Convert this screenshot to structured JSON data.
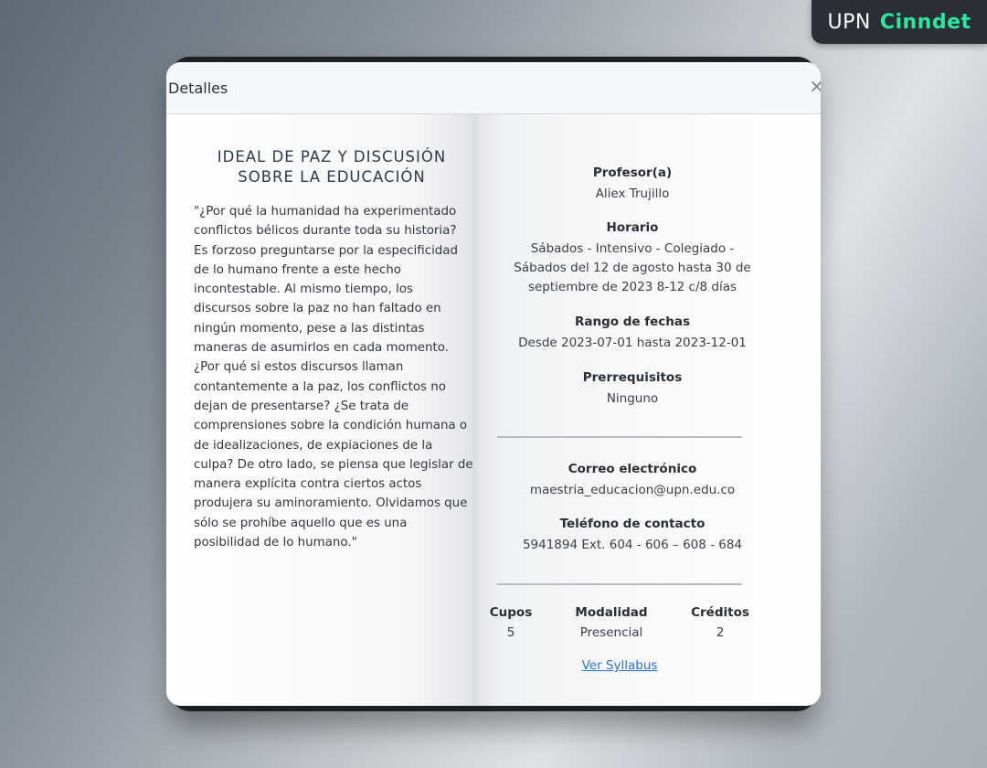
{
  "brand": {
    "part1": "UPN",
    "part2": "Cinndet",
    "accent_color": "#2ee6a0"
  },
  "modal": {
    "title": "Detalles",
    "close_icon": "×"
  },
  "course": {
    "title_line1": "IDEAL DE PAZ Y DISCUSIÓN",
    "title_line2": "SOBRE LA EDUCACIÓN",
    "description": "\"¿Por qué la humanidad ha experimentado conflictos bélicos durante toda su historia? Es forzoso preguntarse por la especificidad de lo humano frente a este hecho incontestable. Al mismo tiempo, los discursos sobre la paz no han faltado en ningún momento, pese a las distintas maneras de asumirlos en cada momento. ¿Por qué si estos discursos llaman contantemente a la paz, los conflictos no dejan de presentarse? ¿Se trata de comprensiones sobre la condición humana o de idealizaciones, de expiaciones de la culpa? De otro lado, se piensa que legislar de manera explícita contra ciertos actos produjera su aminoramiento. Olvidamos que sólo se prohíbe aquello que es una posibilidad de lo humano.\""
  },
  "details": {
    "profesor_label": "Profesor(a)",
    "profesor_value": "Aliex Trujillo",
    "horario_label": "Horario",
    "horario_value": "Sábados - Intensivo - Colegiado - Sábados del 12 de agosto hasta 30 de septiembre de 2023 8-12 c/8 días",
    "rango_label": "Rango de fechas",
    "rango_value": "Desde 2023-07-01 hasta 2023-12-01",
    "prerrequisitos_label": "Prerrequisitos",
    "prerrequisitos_value": "Ninguno",
    "correo_label": "Correo electrónico",
    "correo_value": "maestria_educacion@upn.edu.co",
    "telefono_label": "Teléfono de contacto",
    "telefono_value": "5941894 Ext. 604 - 606 – 608 - 684"
  },
  "stats": {
    "cupos_label": "Cupos",
    "cupos_value": "5",
    "modalidad_label": "Modalidad",
    "modalidad_value": "Presencial",
    "creditos_label": "Créditos",
    "creditos_value": "2"
  },
  "syllabus_link": "Ver Syllabus"
}
